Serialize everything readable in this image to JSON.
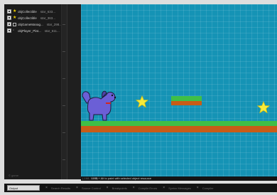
{
  "resource_tree": {
    "items": [
      {
        "name": "objCollectible",
        "resource": "star_633...",
        "icon": "star-icon"
      },
      {
        "name": "objCollectible",
        "resource": "star_363...",
        "icon": "star-icon"
      },
      {
        "name": "objGameManag...",
        "resource": "star_298...",
        "icon": "frame-icon"
      },
      {
        "name": "objPlayer_Plat...",
        "resource": "star_611...",
        "icon": "player-icon"
      }
    ],
    "footer": "© game"
  },
  "status_bar": {
    "coords": "(-168, 1573)",
    "hint": "LMB + Alt to paint with selected object resource"
  },
  "bottom_tabs": {
    "output": "Output",
    "tabs": [
      "Search Results",
      "Source Control",
      "Breakpoints",
      "Compile Errors",
      "Syntax Messages",
      "Compiler"
    ]
  },
  "level": {
    "background_color": "#1593b5",
    "grass_color": "#3fbf47",
    "dirt_color": "#c85c17",
    "star_color": "#f7eb3a",
    "player_color": "#6b5fd6"
  }
}
